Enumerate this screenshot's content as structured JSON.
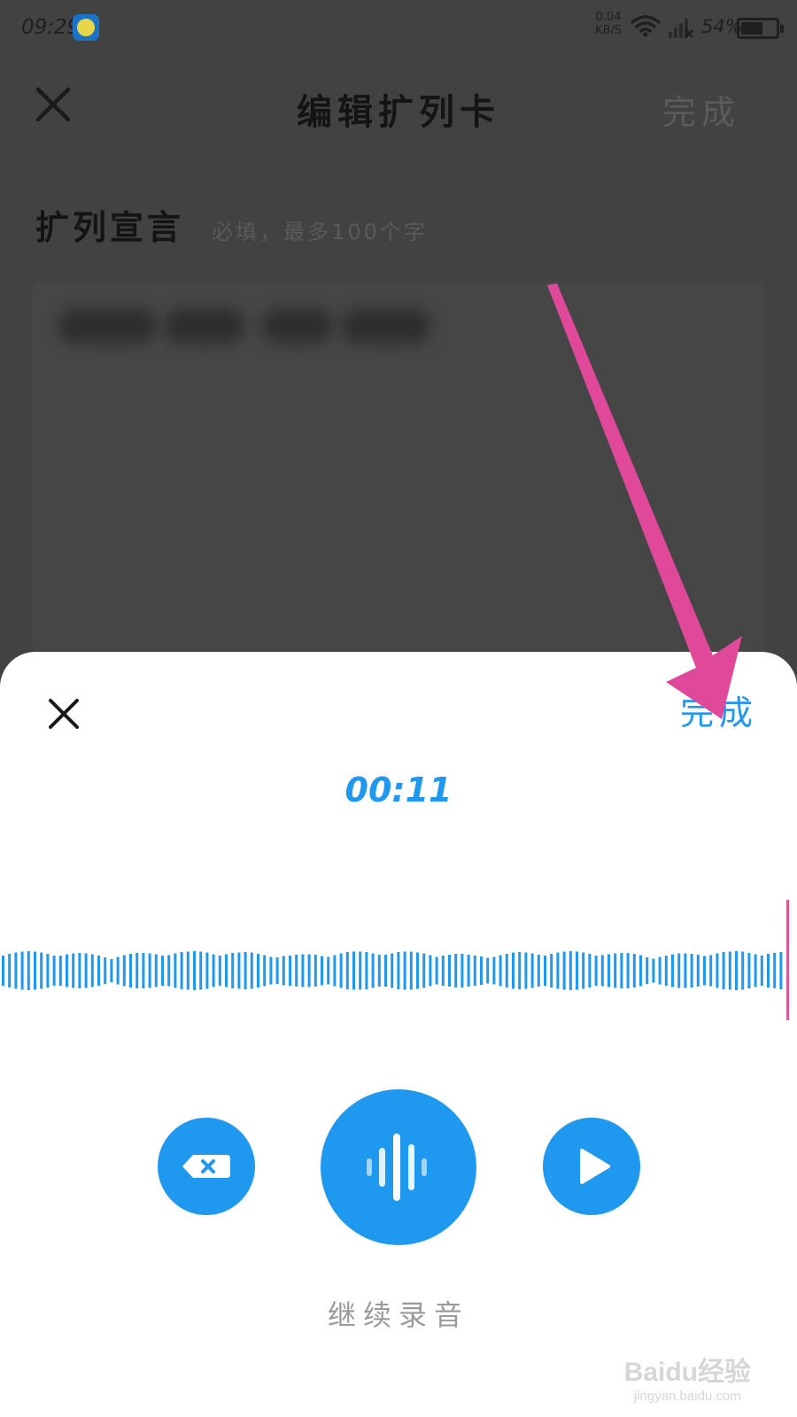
{
  "status_bar": {
    "time": "09:29",
    "net_speed_value": "0.04",
    "net_speed_unit": "KB/S",
    "battery": "54%"
  },
  "background_page": {
    "title": "编辑扩列卡",
    "done_label": "完成",
    "section_title": "扩列宣言",
    "section_hint": "必填，最多100个字"
  },
  "recorder": {
    "done_label": "完成",
    "timer": "00:11",
    "action_label": "继续录音"
  },
  "watermark": {
    "logo": "Baidu经验",
    "url": "jingyan.baidu.com"
  },
  "colors": {
    "accent": "#1f98f0",
    "annotation_arrow": "#e0489a",
    "playhead": "#e0588e"
  },
  "icons": {
    "delete": "backspace-x-icon",
    "record": "sound-wave-icon",
    "play": "play-icon",
    "close": "close-x-icon"
  }
}
